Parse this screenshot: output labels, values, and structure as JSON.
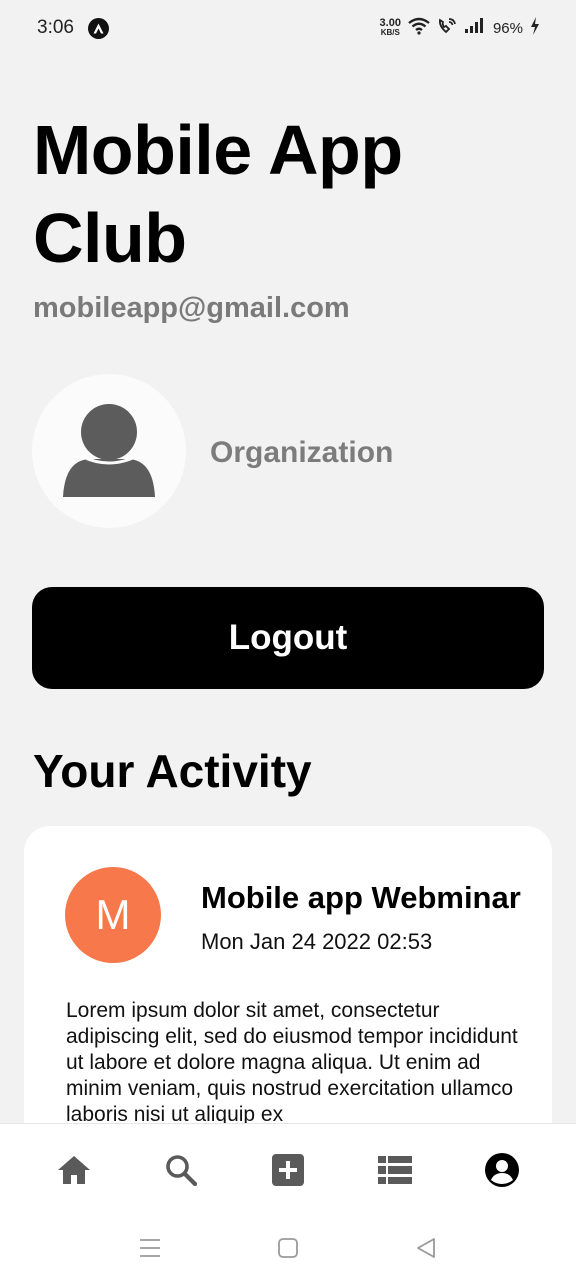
{
  "status_bar": {
    "time": "3:06",
    "net_speed_value": "3.00",
    "net_speed_unit": "KB/S",
    "battery": "96%"
  },
  "profile": {
    "name": "Mobile App Club",
    "email": "mobileapp@gmail.com",
    "role": "Organization"
  },
  "logout_label": "Logout",
  "activity": {
    "section_title": "Your Activity",
    "items": [
      {
        "avatar_letter": "M",
        "avatar_color": "#f7784b",
        "title": "Mobile app Webminar",
        "date": "Mon Jan 24 2022 02:53",
        "body": "Lorem ipsum dolor sit amet, consectetur adipiscing elit, sed do eiusmod tempor incididunt ut labore et dolore magna aliqua. Ut enim ad minim veniam, quis nostrud exercitation ullamco laboris nisi ut aliquip ex"
      }
    ]
  },
  "bottom_nav": [
    "home-icon",
    "search-icon",
    "add-icon",
    "list-icon",
    "profile-icon"
  ],
  "colors": {
    "background": "#f2f2f2",
    "button": "#000000",
    "accent": "#f7784b"
  }
}
